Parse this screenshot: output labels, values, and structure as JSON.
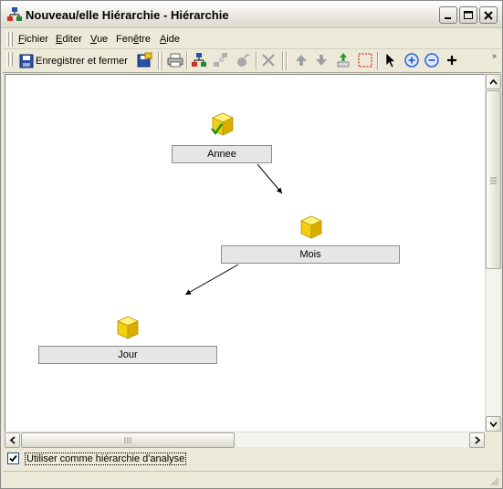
{
  "window": {
    "title": "Nouveau/elle Hiérarchie - Hiérarchie"
  },
  "menu": {
    "items": [
      {
        "label": "Fichier",
        "underline": "F"
      },
      {
        "label": "Editer",
        "underline": "E"
      },
      {
        "label": "Vue",
        "underline": "V"
      },
      {
        "label": "Fenêtre",
        "underline": "ê"
      },
      {
        "label": "Aide",
        "underline": "A"
      }
    ]
  },
  "toolbar": {
    "save_label": "Enregistrer et fermer",
    "icons": [
      "save-icon",
      "save-as-icon",
      "print-icon",
      "hierarchy-icon",
      "hierarchy-disabled-icon",
      "bomb-icon",
      "delete-icon",
      "move-up-icon",
      "move-down-icon",
      "add-level-icon",
      "selection-rect-icon",
      "pointer-icon",
      "zoom-in-icon",
      "zoom-out-icon",
      "plus-icon"
    ]
  },
  "diagram": {
    "nodes": [
      {
        "label": "Annee",
        "icon": "cube-checked-icon"
      },
      {
        "label": "Mois",
        "icon": "cube-icon"
      },
      {
        "label": "Jour",
        "icon": "cube-icon"
      }
    ],
    "edges": [
      {
        "from": "Annee",
        "to": "Mois"
      },
      {
        "from": "Mois",
        "to": "Jour"
      }
    ]
  },
  "options": {
    "analysis_checkbox_label": "Utiliser comme hiérarchie d'analyse",
    "analysis_checked": true
  },
  "colors": {
    "node_fill": "#e6e6e6",
    "cube_yellow": "#f5d315",
    "canvas_bg": "#ffffff",
    "chrome_bg": "#ece9d8"
  }
}
